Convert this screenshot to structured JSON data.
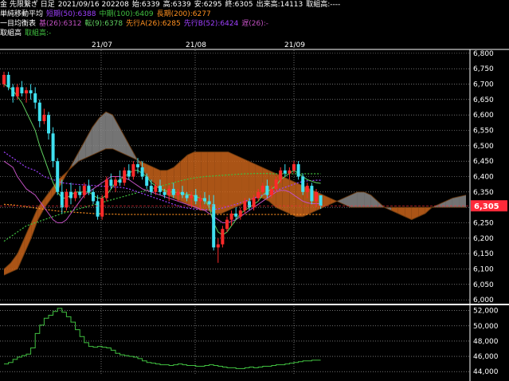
{
  "header": {
    "line1": {
      "instrument": "金 先限繋ぎ 日足",
      "date": "2021/09/16 202208",
      "open": "始:6339",
      "high": "高:6339",
      "low": "安:6295",
      "close": "終:6305",
      "volume": "出来高:14113",
      "oi": "取組高:----"
    },
    "line2": {
      "title": "単純移動平均",
      "short": "短期(50):6388",
      "mid": "中期(100):6409",
      "long": "長期(200):6277"
    },
    "line3": {
      "title": "一目均衡表",
      "base": "基(26):6312",
      "conv": "転(9):6378",
      "spanA": "先行A(26):6285",
      "spanB": "先行B(52):6424",
      "lag": "遅(26):-"
    },
    "line4": {
      "title": "取組高",
      "label": "取組高:-"
    }
  },
  "colors": {
    "background": "#000000",
    "up_candle": "#ff2a2a",
    "down_candle": "#40e0f0",
    "sma50": "#a040ff",
    "sma100": "#40c040",
    "sma200": "#ff9020",
    "ichimoku_base": "#c050c0",
    "ichimoku_conv": "#60d060",
    "kumo_bull": "#c8631a",
    "kumo_bear": "#888888",
    "oi_line": "#40c040",
    "price_tag": "#ff2a3a",
    "grid": "#ffffff"
  },
  "chart_data": [
    {
      "type": "candlestick",
      "title": "",
      "x_labels": [
        "21/07",
        "21/08",
        "21/09"
      ],
      "y_ticks": [
        "6,800",
        "6,750",
        "6,700",
        "6,650",
        "6,600",
        "6,550",
        "6,500",
        "6,450",
        "6,400",
        "6,350",
        "6,300",
        "6,250",
        "6,200",
        "6,150",
        "6,100",
        "6,050",
        "6,000"
      ],
      "ylim": [
        5990,
        6810
      ],
      "last_price_label": "6,305",
      "last_price": 6305,
      "candles": [
        [
          6700,
          6740,
          6690,
          6730
        ],
        [
          6730,
          6740,
          6680,
          6690
        ],
        [
          6690,
          6700,
          6640,
          6660
        ],
        [
          6660,
          6700,
          6650,
          6690
        ],
        [
          6690,
          6710,
          6660,
          6670
        ],
        [
          6670,
          6690,
          6640,
          6680
        ],
        [
          6680,
          6700,
          6650,
          6670
        ],
        [
          6670,
          6690,
          6620,
          6640
        ],
        [
          6640,
          6650,
          6560,
          6580
        ],
        [
          6580,
          6620,
          6570,
          6600
        ],
        [
          6600,
          6610,
          6520,
          6540
        ],
        [
          6540,
          6560,
          6430,
          6450
        ],
        [
          6450,
          6460,
          6340,
          6350
        ],
        [
          6350,
          6390,
          6280,
          6300
        ],
        [
          6300,
          6360,
          6290,
          6350
        ],
        [
          6350,
          6380,
          6310,
          6330
        ],
        [
          6330,
          6360,
          6320,
          6350
        ],
        [
          6350,
          6370,
          6330,
          6340
        ],
        [
          6340,
          6380,
          6330,
          6370
        ],
        [
          6370,
          6390,
          6340,
          6350
        ],
        [
          6350,
          6360,
          6310,
          6320
        ],
        [
          6320,
          6340,
          6260,
          6270
        ],
        [
          6270,
          6340,
          6260,
          6330
        ],
        [
          6330,
          6400,
          6320,
          6390
        ],
        [
          6390,
          6410,
          6360,
          6370
        ],
        [
          6370,
          6400,
          6350,
          6390
        ],
        [
          6390,
          6420,
          6370,
          6380
        ],
        [
          6380,
          6430,
          6370,
          6420
        ],
        [
          6420,
          6440,
          6390,
          6400
        ],
        [
          6400,
          6450,
          6390,
          6440
        ],
        [
          6440,
          6460,
          6410,
          6430
        ],
        [
          6430,
          6450,
          6390,
          6400
        ],
        [
          6400,
          6410,
          6360,
          6370
        ],
        [
          6370,
          6390,
          6340,
          6350
        ],
        [
          6350,
          6380,
          6340,
          6370
        ],
        [
          6370,
          6390,
          6340,
          6350
        ],
        [
          6350,
          6360,
          6330,
          6340
        ],
        [
          6340,
          6370,
          6320,
          6360
        ],
        [
          6360,
          6380,
          6330,
          6340
        ],
        [
          6340,
          6360,
          6320,
          6350
        ],
        [
          6350,
          6370,
          6330,
          6340
        ],
        [
          6340,
          6350,
          6320,
          6330
        ],
        [
          6330,
          6350,
          6300,
          6340
        ],
        [
          6340,
          6360,
          6310,
          6320
        ],
        [
          6320,
          6340,
          6290,
          6330
        ],
        [
          6330,
          6350,
          6310,
          6320
        ],
        [
          6320,
          6340,
          6300,
          6310
        ],
        [
          6310,
          6340,
          6160,
          6170
        ],
        [
          6170,
          6200,
          6120,
          6180
        ],
        [
          6180,
          6240,
          6170,
          6230
        ],
        [
          6230,
          6270,
          6220,
          6260
        ],
        [
          6260,
          6290,
          6240,
          6280
        ],
        [
          6280,
          6300,
          6260,
          6270
        ],
        [
          6270,
          6300,
          6260,
          6290
        ],
        [
          6290,
          6330,
          6280,
          6320
        ],
        [
          6320,
          6330,
          6290,
          6300
        ],
        [
          6300,
          6340,
          6290,
          6330
        ],
        [
          6330,
          6360,
          6320,
          6350
        ],
        [
          6350,
          6380,
          6340,
          6370
        ],
        [
          6370,
          6390,
          6330,
          6340
        ],
        [
          6340,
          6370,
          6330,
          6360
        ],
        [
          6360,
          6400,
          6350,
          6390
        ],
        [
          6390,
          6430,
          6380,
          6420
        ],
        [
          6420,
          6440,
          6400,
          6410
        ],
        [
          6410,
          6430,
          6390,
          6420
        ],
        [
          6420,
          6450,
          6410,
          6440
        ],
        [
          6440,
          6450,
          6390,
          6400
        ],
        [
          6400,
          6410,
          6340,
          6350
        ],
        [
          6350,
          6380,
          6330,
          6370
        ],
        [
          6370,
          6380,
          6310,
          6320
        ],
        [
          6320,
          6360,
          6300,
          6350
        ],
        [
          6339,
          6339,
          6295,
          6305
        ]
      ],
      "kumo_span_a": [
        6080,
        6090,
        6100,
        6150,
        6200,
        6260,
        6300,
        6330,
        6360,
        6400,
        6440,
        6480,
        6520,
        6560,
        6590,
        6610,
        6600,
        6560,
        6520,
        6480,
        6440,
        6400,
        6380,
        6360,
        6340,
        6330,
        6320,
        6310,
        6300,
        6290,
        6290,
        6280,
        6280,
        6290,
        6300,
        6310,
        6320,
        6330,
        6330,
        6320,
        6300,
        6290,
        6280,
        6270,
        6270,
        6280,
        6290,
        6300,
        6310,
        6320,
        6330,
        6340,
        6350,
        6350,
        6340,
        6320,
        6300,
        6290,
        6280,
        6270,
        6260,
        6270,
        6280,
        6300,
        6310,
        6320,
        6330,
        6335,
        6340
      ],
      "kumo_span_b": [
        6100,
        6120,
        6150,
        6200,
        6250,
        6300,
        6330,
        6360,
        6390,
        6410,
        6430,
        6450,
        6460,
        6470,
        6480,
        6490,
        6490,
        6480,
        6470,
        6460,
        6450,
        6440,
        6430,
        6420,
        6420,
        6430,
        6450,
        6470,
        6480,
        6480,
        6480,
        6480,
        6480,
        6480,
        6470,
        6460,
        6450,
        6440,
        6430,
        6420,
        6410,
        6400,
        6390,
        6380,
        6370,
        6360,
        6350,
        6340,
        6330,
        6320,
        6310,
        6300,
        6300,
        6300,
        6300,
        6300,
        6300,
        6300,
        6300,
        6300,
        6300,
        6300,
        6300,
        6300,
        6300,
        6300,
        6300,
        6300,
        6300
      ],
      "sma50": [
        6480,
        6470,
        6460,
        6450,
        6440,
        6430,
        6425,
        6420,
        6410,
        6400,
        6395,
        6390,
        6385,
        6380,
        6378,
        6376,
        6375,
        6374,
        6373,
        6372,
        6371,
        6370,
        6369,
        6368,
        6367,
        6366,
        6365,
        6363,
        6360,
        6355,
        6350,
        6345,
        6340,
        6335,
        6330,
        6325,
        6320,
        6315,
        6310,
        6305,
        6300,
        6298,
        6296,
        6294,
        6293,
        6292,
        6292,
        6293,
        6295,
        6298,
        6302,
        6306,
        6310,
        6315,
        6320,
        6325,
        6330,
        6335,
        6340,
        6345,
        6350,
        6355,
        6360,
        6365,
        6370,
        6375,
        6380,
        6384,
        6386,
        6387,
        6388,
        6388
      ],
      "sma100": [
        6190,
        6200,
        6210,
        6220,
        6230,
        6240,
        6245,
        6250,
        6255,
        6260,
        6265,
        6270,
        6275,
        6280,
        6284,
        6288,
        6292,
        6296,
        6300,
        6304,
        6308,
        6312,
        6316,
        6320,
        6324,
        6328,
        6332,
        6336,
        6340,
        6344,
        6348,
        6352,
        6356,
        6360,
        6364,
        6368,
        6372,
        6376,
        6380,
        6384,
        6388,
        6391,
        6394,
        6396,
        6398,
        6400,
        6401,
        6402,
        6403,
        6404,
        6405,
        6406,
        6407,
        6408,
        6409,
        6409,
        6410,
        6410,
        6410,
        6410,
        6409,
        6409,
        6409,
        6409,
        6409,
        6409,
        6409,
        6409,
        6409,
        6409,
        6409,
        6409
      ],
      "sma200": [
        6310,
        6309,
        6308,
        6306,
        6304,
        6302,
        6300,
        6298,
        6296,
        6294,
        6292,
        6290,
        6288,
        6287,
        6286,
        6285,
        6284,
        6283,
        6282,
        6281,
        6280,
        6279,
        6279,
        6278,
        6278,
        6278,
        6277,
        6277,
        6277,
        6277,
        6277,
        6277,
        6277,
        6277,
        6277,
        6277,
        6277,
        6277,
        6277,
        6277,
        6277,
        6277,
        6277,
        6277,
        6277,
        6277,
        6277,
        6277,
        6277,
        6277,
        6277,
        6277,
        6277,
        6277,
        6277,
        6277,
        6277,
        6277,
        6277,
        6277,
        6277,
        6277,
        6277,
        6277,
        6277,
        6277,
        6277,
        6277,
        6277,
        6277,
        6277,
        6277
      ],
      "ichimoku_base": [
        6450,
        6440,
        6430,
        6400,
        6380,
        6360,
        6350,
        6340,
        6320,
        6300,
        6280,
        6260,
        6250,
        6250,
        6260,
        6280,
        6300,
        6320,
        6340,
        6350,
        6360,
        6370,
        6380,
        6390,
        6400,
        6400,
        6400,
        6395,
        6390,
        6380,
        6370,
        6360,
        6355,
        6350,
        6345,
        6340,
        6335,
        6330,
        6325,
        6320,
        6315,
        6310,
        6305,
        6300,
        6295,
        6290,
        6280,
        6270,
        6260,
        6250,
        6250,
        6255,
        6260,
        6270,
        6280,
        6290,
        6300,
        6310,
        6320,
        6330,
        6340,
        6350,
        6355,
        6355,
        6350,
        6340,
        6330,
        6320,
        6315,
        6312,
        6312,
        6312
      ],
      "ichimoku_conv": [
        6700,
        6690,
        6680,
        6660,
        6640,
        6610,
        6580,
        6550,
        6500,
        6460,
        6420,
        6380,
        6350,
        6330,
        6330,
        6340,
        6350,
        6350,
        6350,
        6350,
        6340,
        6330,
        6330,
        6340,
        6360,
        6380,
        6390,
        6400,
        6410,
        6420,
        6420,
        6410,
        6400,
        6380,
        6370,
        6360,
        6355,
        6350,
        6350,
        6348,
        6345,
        6342,
        6340,
        6335,
        6330,
        6325,
        6300,
        6250,
        6220,
        6210,
        6220,
        6240,
        6260,
        6280,
        6290,
        6300,
        6310,
        6320,
        6340,
        6350,
        6360,
        6370,
        6390,
        6400,
        6410,
        6420,
        6410,
        6400,
        6390,
        6385,
        6380,
        6378
      ]
    },
    {
      "type": "line",
      "title": "",
      "series_name": "取組高",
      "y_ticks": [
        "52,000",
        "50,000",
        "48,000",
        "46,000",
        "44,000"
      ],
      "ylim": [
        43600,
        52600
      ],
      "values": [
        45000,
        45200,
        45600,
        45900,
        46100,
        46300,
        47100,
        49000,
        50100,
        51000,
        51400,
        51900,
        52300,
        51800,
        51200,
        50500,
        49500,
        48600,
        47800,
        47300,
        47200,
        47300,
        47200,
        47100,
        46800,
        46400,
        46200,
        46100,
        46000,
        45900,
        45700,
        45400,
        45200,
        45100,
        45000,
        44900,
        44900,
        44800,
        44900,
        45000,
        44900,
        44800,
        44800,
        44700,
        44700,
        44800,
        44900,
        44800,
        44700,
        44600,
        44500,
        44500,
        44400,
        44400,
        44500,
        44600,
        44500,
        44600,
        44700,
        44700,
        44800,
        44900,
        44900,
        45000,
        45100,
        45200,
        45300,
        45400,
        45400,
        45500,
        45500,
        45500
      ]
    }
  ]
}
